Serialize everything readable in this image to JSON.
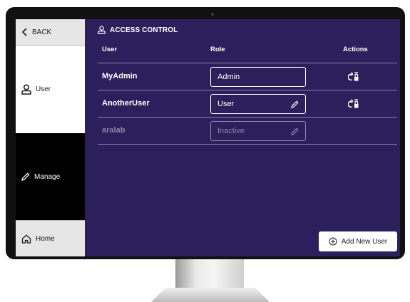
{
  "sidebar": {
    "back_label": "BACK",
    "user_label": "User",
    "manage_label": "Manage",
    "home_label": "Home"
  },
  "header": {
    "title": "ACCESS CONTROL"
  },
  "table": {
    "columns": {
      "user": "User",
      "role": "Role",
      "actions": "Actions"
    },
    "rows": [
      {
        "user": "MyAdmin",
        "role": "Admin",
        "editable": false,
        "active": true
      },
      {
        "user": "AnotherUser",
        "role": "User",
        "editable": true,
        "active": true
      },
      {
        "user": "aralab",
        "role": "Inactive",
        "editable": true,
        "active": false
      }
    ]
  },
  "add_button": {
    "label": "Add New User"
  },
  "colors": {
    "screen_bg": "#2b1f5c",
    "sidebar_active": "#000000",
    "sidebar_selected": "#ffffff",
    "sidebar_default": "#e6e6e6",
    "inactive_text": "#8c86a8"
  }
}
